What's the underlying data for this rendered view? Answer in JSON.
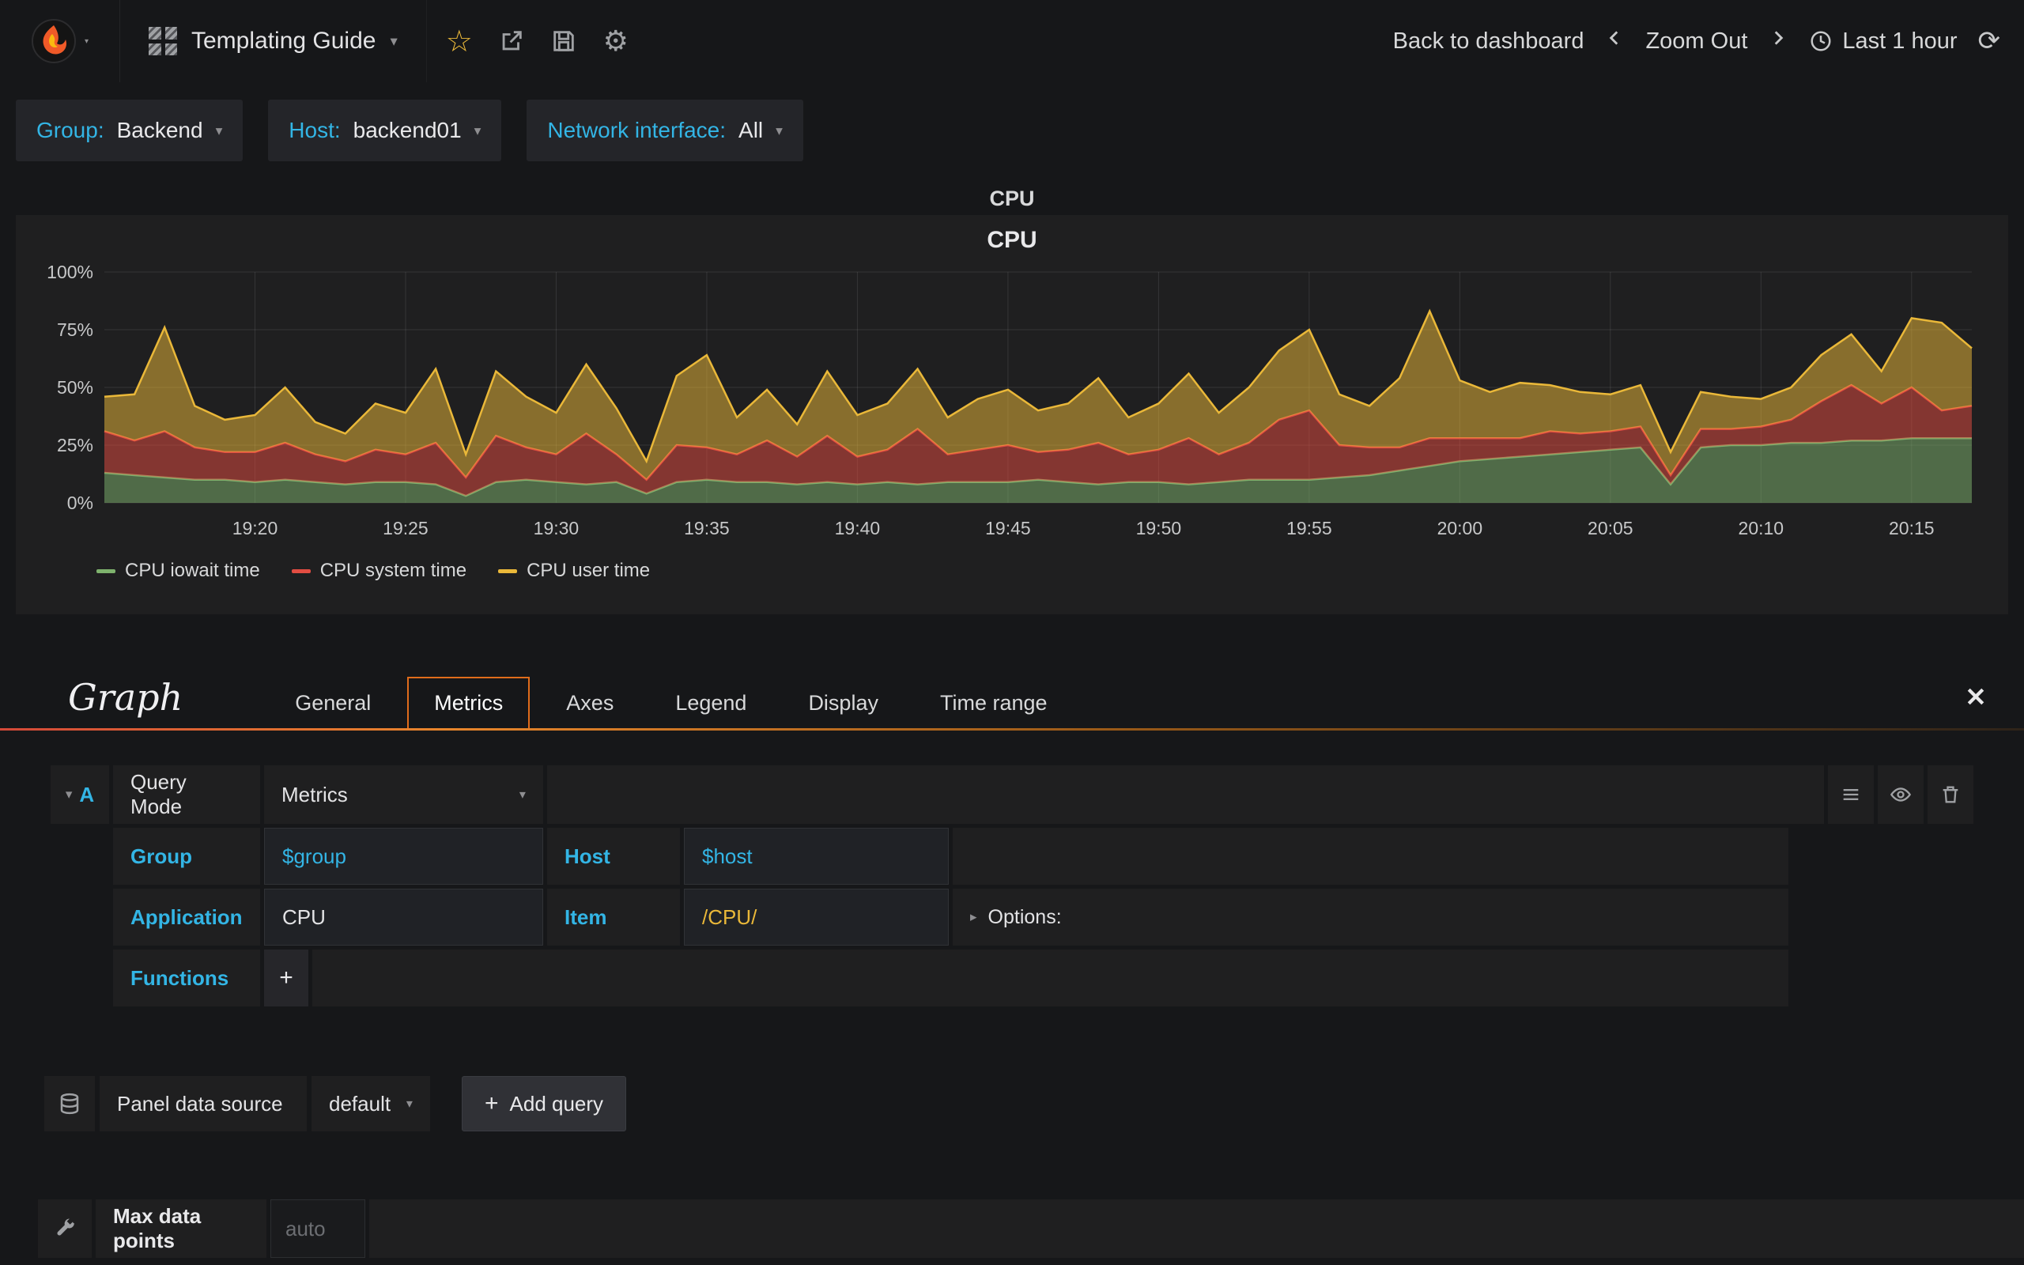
{
  "navbar": {
    "title": "Templating Guide",
    "back_to_dashboard": "Back to dashboard",
    "zoom_out": "Zoom Out",
    "time_range": "Last 1 hour"
  },
  "icons": {
    "caret_down": "▾",
    "caret_right": "▸",
    "star": "☆",
    "gear": "⚙",
    "refresh": "⟳",
    "plus": "+"
  },
  "variables": [
    {
      "label": "Group:",
      "value": "Backend"
    },
    {
      "label": "Host:",
      "value": "backend01"
    },
    {
      "label": "Network interface:",
      "value": "All"
    }
  ],
  "panel": {
    "header_title": "CPU"
  },
  "chart_data": {
    "type": "area",
    "stacked": true,
    "title": "CPU",
    "xlabel": "",
    "ylabel": "",
    "ylim": [
      0,
      100
    ],
    "y_tick_step": 25,
    "y_tick_suffix": "%",
    "grid": true,
    "legend_position": "bottom-left",
    "x_start": "19:15",
    "x_step_minutes": 1,
    "x_ticks": [
      "19:20",
      "19:25",
      "19:30",
      "19:35",
      "19:40",
      "19:45",
      "19:50",
      "19:55",
      "20:00",
      "20:05",
      "20:10",
      "20:15"
    ],
    "x_tick_indices": [
      5,
      10,
      15,
      20,
      25,
      30,
      35,
      40,
      45,
      50,
      55,
      60
    ],
    "series": [
      {
        "name": "CPU iowait time",
        "color": "#7EB26D",
        "values": [
          13,
          12,
          11,
          10,
          10,
          9,
          10,
          9,
          8,
          9,
          9,
          8,
          3,
          9,
          10,
          9,
          8,
          9,
          4,
          9,
          10,
          9,
          9,
          8,
          9,
          8,
          9,
          8,
          9,
          9,
          9,
          10,
          9,
          8,
          9,
          9,
          8,
          9,
          10,
          10,
          10,
          11,
          12,
          14,
          16,
          18,
          19,
          20,
          21,
          22,
          23,
          24,
          8,
          24,
          25,
          25,
          26,
          26,
          27,
          27,
          28,
          28,
          28
        ]
      },
      {
        "name": "CPU system time",
        "color": "#E24D42",
        "values": [
          18,
          15,
          20,
          14,
          12,
          13,
          16,
          12,
          10,
          14,
          12,
          18,
          8,
          20,
          14,
          12,
          22,
          12,
          6,
          16,
          14,
          12,
          18,
          12,
          20,
          12,
          14,
          24,
          12,
          14,
          16,
          12,
          14,
          18,
          12,
          14,
          20,
          12,
          16,
          26,
          30,
          14,
          12,
          10,
          12,
          10,
          9,
          8,
          10,
          8,
          8,
          9,
          4,
          8,
          7,
          8,
          10,
          18,
          24,
          16,
          22,
          12,
          14
        ]
      },
      {
        "name": "CPU user time",
        "color": "#EAB839",
        "values": [
          15,
          20,
          45,
          18,
          14,
          16,
          24,
          14,
          12,
          20,
          18,
          32,
          10,
          28,
          22,
          18,
          30,
          20,
          8,
          30,
          40,
          16,
          22,
          14,
          28,
          18,
          20,
          26,
          16,
          22,
          24,
          18,
          20,
          28,
          16,
          20,
          28,
          18,
          24,
          30,
          35,
          22,
          18,
          30,
          55,
          25,
          20,
          24,
          20,
          18,
          16,
          18,
          10,
          16,
          14,
          12,
          14,
          20,
          22,
          14,
          30,
          38,
          25
        ]
      }
    ]
  },
  "editor": {
    "panel_type_title": "Graph",
    "tabs": [
      "General",
      "Metrics",
      "Axes",
      "Legend",
      "Display",
      "Time range"
    ],
    "active_tab": "Metrics",
    "query_row": {
      "ref": "A",
      "mode_label": "Query Mode",
      "mode_value": "Metrics"
    },
    "fields": {
      "group_label": "Group",
      "group_value": "$group",
      "host_label": "Host",
      "host_value": "$host",
      "application_label": "Application",
      "application_value": "CPU",
      "item_label": "Item",
      "item_value": "/CPU/",
      "options_label": "Options:",
      "functions_label": "Functions"
    },
    "datasource_row": {
      "label": "Panel data source",
      "value": "default",
      "add_query_label": "Add query"
    },
    "max_data_points": {
      "label": "Max data points",
      "placeholder": "auto"
    }
  },
  "colors": {
    "page_bg": "#161719",
    "panel_bg": "#1f1f20",
    "accent_blue": "#33b5e5",
    "accent_yellow": "#eab839",
    "accent_orange": "#e06c1b"
  }
}
